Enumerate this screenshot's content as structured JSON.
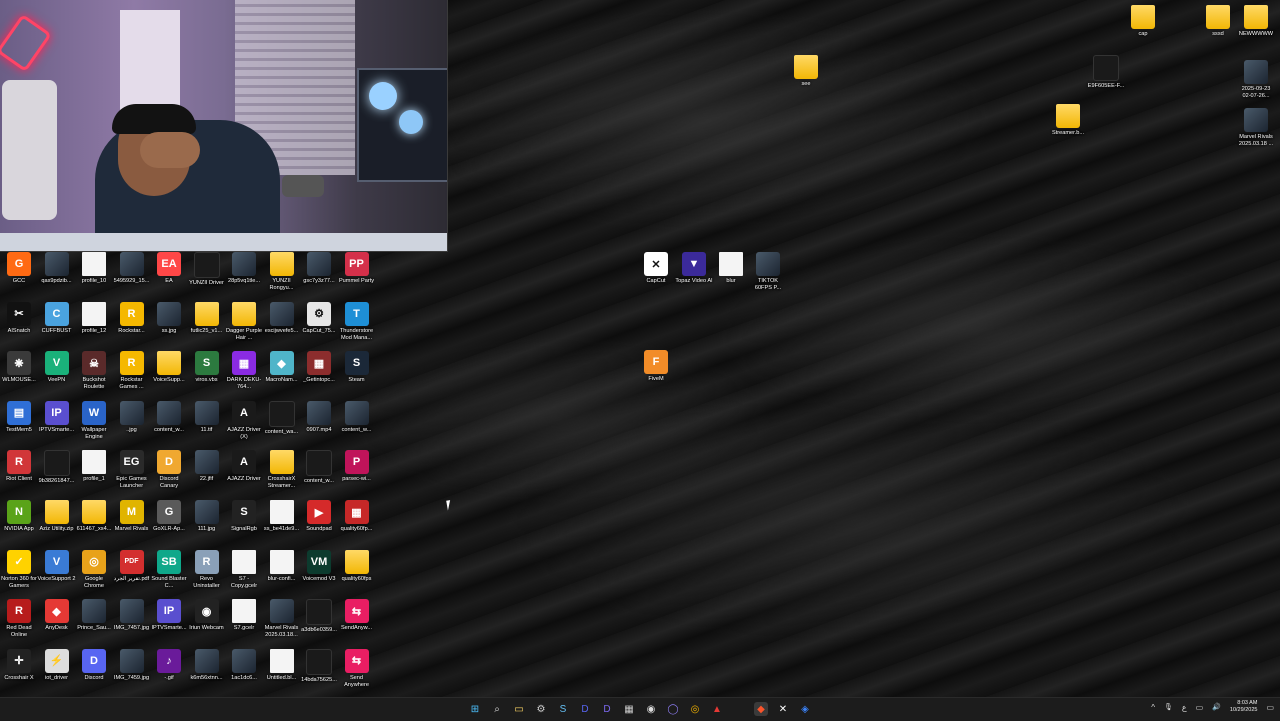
{
  "desktop_icons_left": [
    {
      "label": "GCC",
      "kind": "app",
      "color": "#ff6a13",
      "glyph": "G"
    },
    {
      "label": "qas9pdzib...",
      "kind": "img"
    },
    {
      "label": "profile_10",
      "kind": "file"
    },
    {
      "label": "5495929_15...",
      "kind": "img"
    },
    {
      "label": "EA",
      "kind": "app",
      "color": "#ff4747",
      "glyph": "EA"
    },
    {
      "label": "YUNZII Driver",
      "kind": "dark"
    },
    {
      "label": "28p5vq1tle...",
      "kind": "img"
    },
    {
      "label": "YUNZII Rongyu...",
      "kind": "folder"
    },
    {
      "label": "gsc7y3z77...",
      "kind": "img"
    },
    {
      "label": "Pummel Party",
      "kind": "app",
      "color": "#d4304a",
      "glyph": "PP"
    },
    {
      "label": "AISnatch",
      "kind": "app",
      "color": "#111",
      "glyph": "✂"
    },
    {
      "label": "CUFFBUST",
      "kind": "app",
      "color": "#4aa3df",
      "glyph": "C"
    },
    {
      "label": "profile_12",
      "kind": "file"
    },
    {
      "label": "Rockstar...",
      "kind": "app",
      "color": "#f5b800",
      "glyph": "R"
    },
    {
      "label": "ss.jpg",
      "kind": "img"
    },
    {
      "label": "futlic25_v1...",
      "kind": "folder"
    },
    {
      "label": "Dagger Purple Hair ...",
      "kind": "folder"
    },
    {
      "label": "escijwvefe5...",
      "kind": "img"
    },
    {
      "label": "CapCut_75...",
      "kind": "app",
      "color": "#e6e6e6",
      "glyph": "⚙"
    },
    {
      "label": "Thunderstore Mod Mana...",
      "kind": "app",
      "color": "#1e8fd6",
      "glyph": "T"
    },
    {
      "label": "WLMOUSE...",
      "kind": "app",
      "color": "#3a3a3a",
      "glyph": "❋"
    },
    {
      "label": "VeePN",
      "kind": "app",
      "color": "#1ab17a",
      "glyph": "V"
    },
    {
      "label": "Buckshot Roulette",
      "kind": "app",
      "color": "#5a2a2a",
      "glyph": "☠"
    },
    {
      "label": "Rockstar Games ...",
      "kind": "app",
      "color": "#f5b800",
      "glyph": "R"
    },
    {
      "label": "VoiceSupp...",
      "kind": "folder"
    },
    {
      "label": "viros.vbs",
      "kind": "app",
      "color": "#2c7a3f",
      "glyph": "S"
    },
    {
      "label": "DARK DEKU-764...",
      "kind": "app",
      "color": "#8a2be2",
      "glyph": "▦"
    },
    {
      "label": "MacroNam...",
      "kind": "app",
      "color": "#4fb5c9",
      "glyph": "◆"
    },
    {
      "label": "_Getintopc...",
      "kind": "app",
      "color": "#8c2d2d",
      "glyph": "▦"
    },
    {
      "label": "Steam",
      "kind": "app",
      "color": "#1b2838",
      "glyph": "S"
    },
    {
      "label": "TestMem5",
      "kind": "app",
      "color": "#2f6fd6",
      "glyph": "▤"
    },
    {
      "label": "IPTVSmarte...",
      "kind": "app",
      "color": "#5a4fcf",
      "glyph": "IP"
    },
    {
      "label": "Wallpaper Engine",
      "kind": "app",
      "color": "#2a64c8",
      "glyph": "W"
    },
    {
      "label": "..jpg",
      "kind": "img"
    },
    {
      "label": "content_w...",
      "kind": "img"
    },
    {
      "label": "11.tif",
      "kind": "img"
    },
    {
      "label": "AJAZZ Driver (X)",
      "kind": "app",
      "color": "#1a1a1a",
      "glyph": "A"
    },
    {
      "label": "content_wa...",
      "kind": "dark"
    },
    {
      "label": "0907.mp4",
      "kind": "img"
    },
    {
      "label": "content_w...",
      "kind": "img"
    },
    {
      "label": "Riot Client",
      "kind": "app",
      "color": "#d13639",
      "glyph": "R"
    },
    {
      "label": "9b38261847...",
      "kind": "dark"
    },
    {
      "label": "profile_1",
      "kind": "file"
    },
    {
      "label": "Epic Games Launcher",
      "kind": "app",
      "color": "#2a2a2a",
      "glyph": "EG"
    },
    {
      "label": "Discord Canary",
      "kind": "app",
      "color": "#f0a830",
      "glyph": "D"
    },
    {
      "label": "22.jfif",
      "kind": "img"
    },
    {
      "label": "AJAZZ Driver",
      "kind": "app",
      "color": "#1a1a1a",
      "glyph": "A"
    },
    {
      "label": "CrosshairX Streamer...",
      "kind": "folder"
    },
    {
      "label": "content_w...",
      "kind": "dark"
    },
    {
      "label": "parsec-wi...",
      "kind": "app",
      "color": "#c0145a",
      "glyph": "P"
    },
    {
      "label": "NVIDIA App",
      "kind": "app",
      "color": "#5aa319",
      "glyph": "N"
    },
    {
      "label": "Aziz Utility.zip",
      "kind": "folder"
    },
    {
      "label": "611467_xs4...",
      "kind": "folder"
    },
    {
      "label": "Marvel Rivals",
      "kind": "app",
      "color": "#e0b400",
      "glyph": "M"
    },
    {
      "label": "GoXLR-Ap...",
      "kind": "app",
      "color": "#5a5a5a",
      "glyph": "G"
    },
    {
      "label": "111.jpg",
      "kind": "img"
    },
    {
      "label": "SignalRgb",
      "kind": "app",
      "color": "#222",
      "glyph": "S"
    },
    {
      "label": "ss_be41de9...",
      "kind": "file"
    },
    {
      "label": "Soundpad",
      "kind": "app",
      "color": "#d52a2a",
      "glyph": "▶"
    },
    {
      "label": "quality60fp...",
      "kind": "app",
      "color": "#c62828",
      "glyph": "▦"
    },
    {
      "label": "Norton 360 for Gamers",
      "kind": "app",
      "color": "#ffd200",
      "glyph": "✓"
    },
    {
      "label": "VoiceSupport 2",
      "kind": "app",
      "color": "#3a7bd5",
      "glyph": "V"
    },
    {
      "label": "Google Chrome",
      "kind": "app",
      "color": "#e8a21a",
      "glyph": "◎"
    },
    {
      "label": "تقرير الجرد.pdf",
      "kind": "app",
      "color": "#d32f2f",
      "glyph": "PDF"
    },
    {
      "label": "Sound Blaster C...",
      "kind": "app",
      "color": "#0fa88a",
      "glyph": "SB"
    },
    {
      "label": "Revo Uninstaller",
      "kind": "app",
      "color": "#8aa0b8",
      "glyph": "R"
    },
    {
      "label": "S7 - Copy.gcelr",
      "kind": "file"
    },
    {
      "label": "blur-confi...",
      "kind": "file"
    },
    {
      "label": "Voicemod V3",
      "kind": "app",
      "color": "#0c3b2e",
      "glyph": "VM"
    },
    {
      "label": "quality60fps",
      "kind": "folder"
    },
    {
      "label": "Red Dead Online",
      "kind": "app",
      "color": "#b71c1c",
      "glyph": "R"
    },
    {
      "label": "AnyDesk",
      "kind": "app",
      "color": "#e53935",
      "glyph": "◆"
    },
    {
      "label": "Prince_Sau...",
      "kind": "img"
    },
    {
      "label": "IMG_7457.jpg",
      "kind": "img"
    },
    {
      "label": "IPTVSmarte...",
      "kind": "app",
      "color": "#5a4fcf",
      "glyph": "IP"
    },
    {
      "label": "Iriun Webcam",
      "kind": "app",
      "color": "#222",
      "glyph": "◉"
    },
    {
      "label": "S7.gcelr",
      "kind": "file"
    },
    {
      "label": "Marvel Rivals 2025.03.18...",
      "kind": "img"
    },
    {
      "label": "a3db6e0359...",
      "kind": "dark"
    },
    {
      "label": "SendAnyw...",
      "kind": "app",
      "color": "#e91e63",
      "glyph": "⇆"
    },
    {
      "label": "Crosshair X",
      "kind": "app",
      "color": "#222",
      "glyph": "✛"
    },
    {
      "label": "iot_driver",
      "kind": "app",
      "color": "#ddd",
      "glyph": "⚡"
    },
    {
      "label": "Discord",
      "kind": "app",
      "color": "#5865f2",
      "glyph": "D"
    },
    {
      "label": "IMG_7459.jpg",
      "kind": "img"
    },
    {
      "label": "-.gif",
      "kind": "app",
      "color": "#6a1b9a",
      "glyph": "♪"
    },
    {
      "label": "k6m56xtnn...",
      "kind": "img"
    },
    {
      "label": "1ac1dc6...",
      "kind": "img"
    },
    {
      "label": "Untitled.bl...",
      "kind": "file"
    },
    {
      "label": "14bda75625...",
      "kind": "dark"
    },
    {
      "label": "Send Anywhere",
      "kind": "app",
      "color": "#e91e63",
      "glyph": "⇆"
    }
  ],
  "desktop_icons_float": [
    {
      "id": "see",
      "label": "see",
      "kind": "folder"
    },
    {
      "id": "capcut",
      "label": "CapCut",
      "kind": "app",
      "color": "#ffffff",
      "glyph": "✕"
    },
    {
      "id": "topaz",
      "label": "Topaz Video AI",
      "kind": "app",
      "color": "#3b2a9a",
      "glyph": "▼"
    },
    {
      "id": "blur",
      "label": "blur",
      "kind": "file"
    },
    {
      "id": "tiktok",
      "label": "TIKTOK 60FPS P...",
      "kind": "img"
    },
    {
      "id": "fivem",
      "label": "FiveM",
      "kind": "app",
      "color": "#f28c28",
      "glyph": "F"
    },
    {
      "id": "cap",
      "label": "cap",
      "kind": "folder"
    },
    {
      "id": "sssd",
      "label": "sssd",
      "kind": "folder"
    },
    {
      "id": "newwwww",
      "label": "NEWWWWW",
      "kind": "folder"
    },
    {
      "id": "e9f",
      "label": "E9F605EE-F...",
      "kind": "dark"
    },
    {
      "id": "rec1",
      "label": "2025-09-23 02-07-26...",
      "kind": "img"
    },
    {
      "id": "streamerb",
      "label": "Streamer.b...",
      "kind": "folder"
    },
    {
      "id": "marvel2",
      "label": "Marvel Rivals 2025.03.18 ...",
      "kind": "img"
    }
  ],
  "taskbar": {
    "icons": [
      {
        "name": "start-icon",
        "glyph": "⊞",
        "color": "#4cc2ff"
      },
      {
        "name": "search-icon",
        "glyph": "⌕",
        "color": "#dddddd"
      },
      {
        "name": "file-explorer-icon",
        "glyph": "▭",
        "color": "#ffd966"
      },
      {
        "name": "settings-app-icon",
        "glyph": "⚙",
        "color": "#cccccc"
      },
      {
        "name": "steam-icon",
        "glyph": "S",
        "color": "#66c0f4"
      },
      {
        "name": "discord-icon",
        "glyph": "D",
        "color": "#5865f2"
      },
      {
        "name": "discord-canary-icon",
        "glyph": "D",
        "color": "#7b68ee"
      },
      {
        "name": "calculator-icon",
        "glyph": "▦",
        "color": "#cccccc"
      },
      {
        "name": "obs-icon",
        "glyph": "◉",
        "color": "#dddddd"
      },
      {
        "name": "circle-app-icon",
        "glyph": "◯",
        "color": "#8c7cf0"
      },
      {
        "name": "chrome-icon",
        "glyph": "◎",
        "color": "#f4b400"
      },
      {
        "name": "ajazz-icon",
        "glyph": "▲",
        "color": "#e53935"
      },
      {
        "name": "brave-icon",
        "glyph": "◆",
        "color": "#fb542b"
      },
      {
        "name": "capcut-tray-icon",
        "glyph": "✕",
        "color": "#ffffff"
      },
      {
        "name": "vpn-icon",
        "glyph": "◈",
        "color": "#3b82f6"
      }
    ],
    "tray": {
      "chevron": "^",
      "mic": "🎙",
      "lang": "ع",
      "display": "▭",
      "volume": "🔊",
      "time": "8:03 AM",
      "date": "10/29/2025",
      "notifications": "▭"
    }
  }
}
